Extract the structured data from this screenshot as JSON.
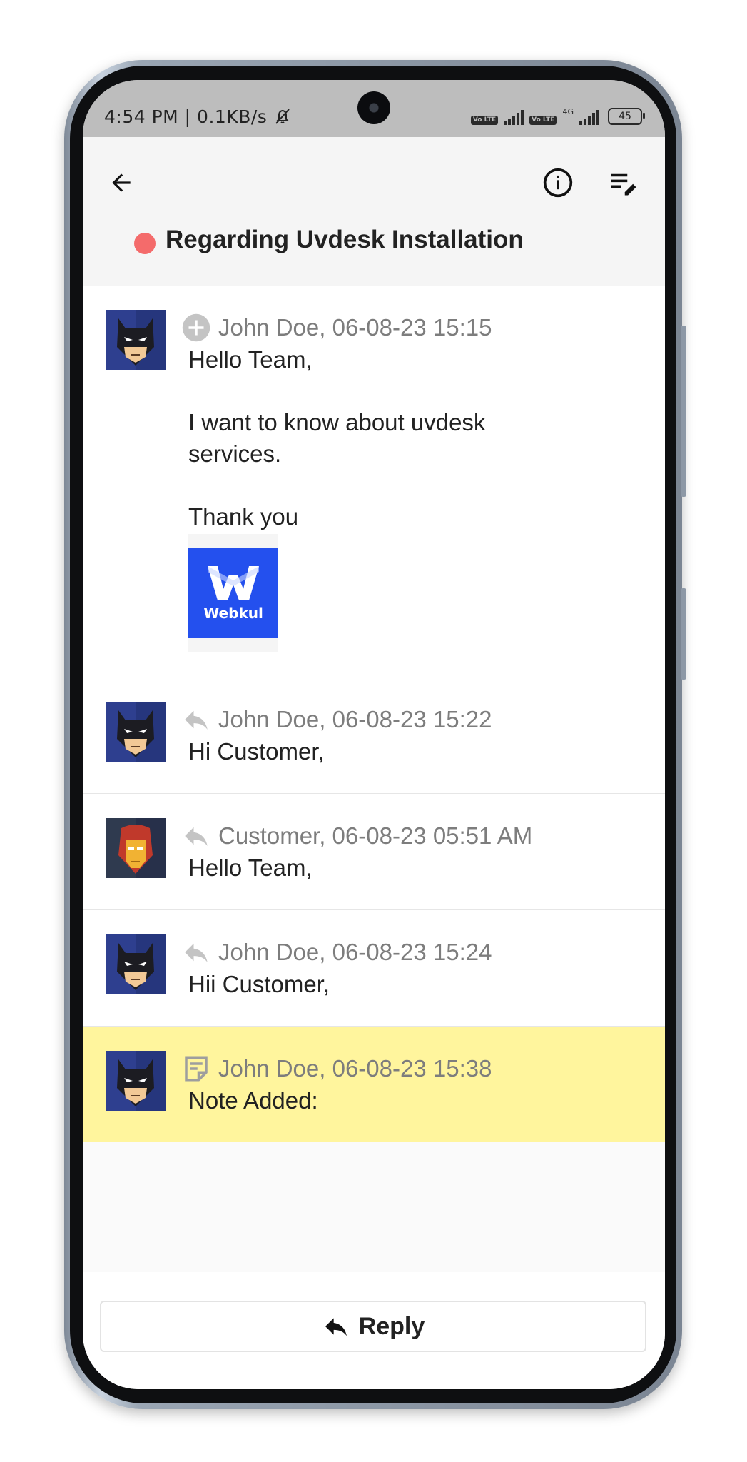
{
  "status": {
    "time": "4:54 PM | 0.1KB/s",
    "battery": "45",
    "network_tag": "4G",
    "volte_label": "Vo LTE"
  },
  "header": {
    "title": "Regarding Uvdesk Installation",
    "status_color": "#f46b6b"
  },
  "messages": [
    {
      "type": "create",
      "type_icon": "plus-circle-icon",
      "author": "John Doe",
      "time": "06-08-23 15:15",
      "meta": "John Doe, 06-08-23 15:15",
      "body": [
        "Hello Team,",
        "",
        "I want to know about uvdesk",
        "services.",
        "",
        "Thank you"
      ],
      "attachment_label": "Webkul",
      "avatar": "batman-avatar"
    },
    {
      "type": "reply",
      "type_icon": "reply-icon",
      "meta": "John Doe, 06-08-23 15:22",
      "body": [
        "Hi Customer,"
      ],
      "avatar": "batman-avatar"
    },
    {
      "type": "reply",
      "type_icon": "reply-icon",
      "meta": "Customer, 06-08-23 05:51 AM",
      "body": [
        "Hello Team,"
      ],
      "avatar": "ironman-avatar"
    },
    {
      "type": "reply",
      "type_icon": "reply-icon",
      "meta": "John Doe, 06-08-23 15:24",
      "body": [
        "Hii Customer,"
      ],
      "avatar": "batman-avatar"
    },
    {
      "type": "note",
      "type_icon": "note-icon",
      "meta": "John Doe, 06-08-23 15:38",
      "body": [
        "Note Added:"
      ],
      "avatar": "batman-avatar",
      "highlight_color": "#fff59d"
    }
  ],
  "reply_button": {
    "label": "Reply"
  }
}
